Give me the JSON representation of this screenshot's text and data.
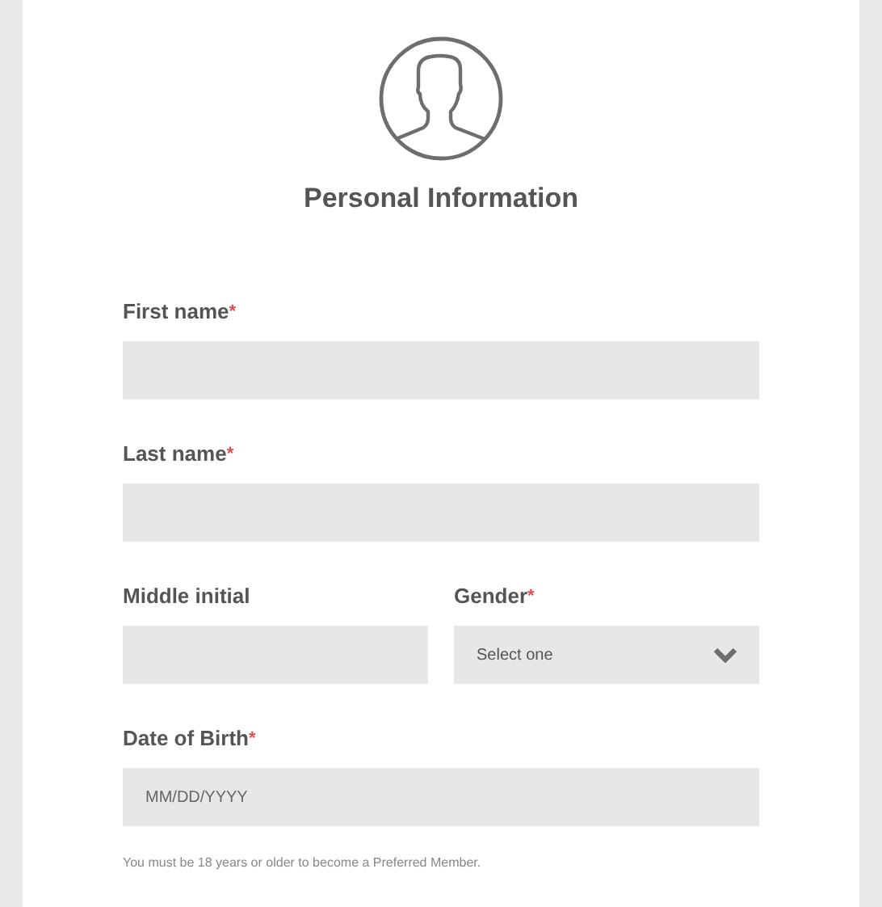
{
  "title": "Personal Information",
  "rows": [
    [
      {
        "kind": "text",
        "label": "First name",
        "required_mark": "*"
      }
    ],
    [
      {
        "kind": "text",
        "label": "Last name",
        "required_mark": "*"
      }
    ],
    [
      {
        "kind": "text",
        "label": "Middle initial"
      },
      {
        "kind": "select",
        "label": "Gender",
        "required_mark": "*",
        "placeholder": "Select one"
      }
    ],
    [
      {
        "kind": "text",
        "label": "Date of Birth",
        "required_mark": "*",
        "placeholder": "MM/DD/YYYY"
      }
    ]
  ],
  "note": "You must be 18 years or older to become a Preferred Member."
}
